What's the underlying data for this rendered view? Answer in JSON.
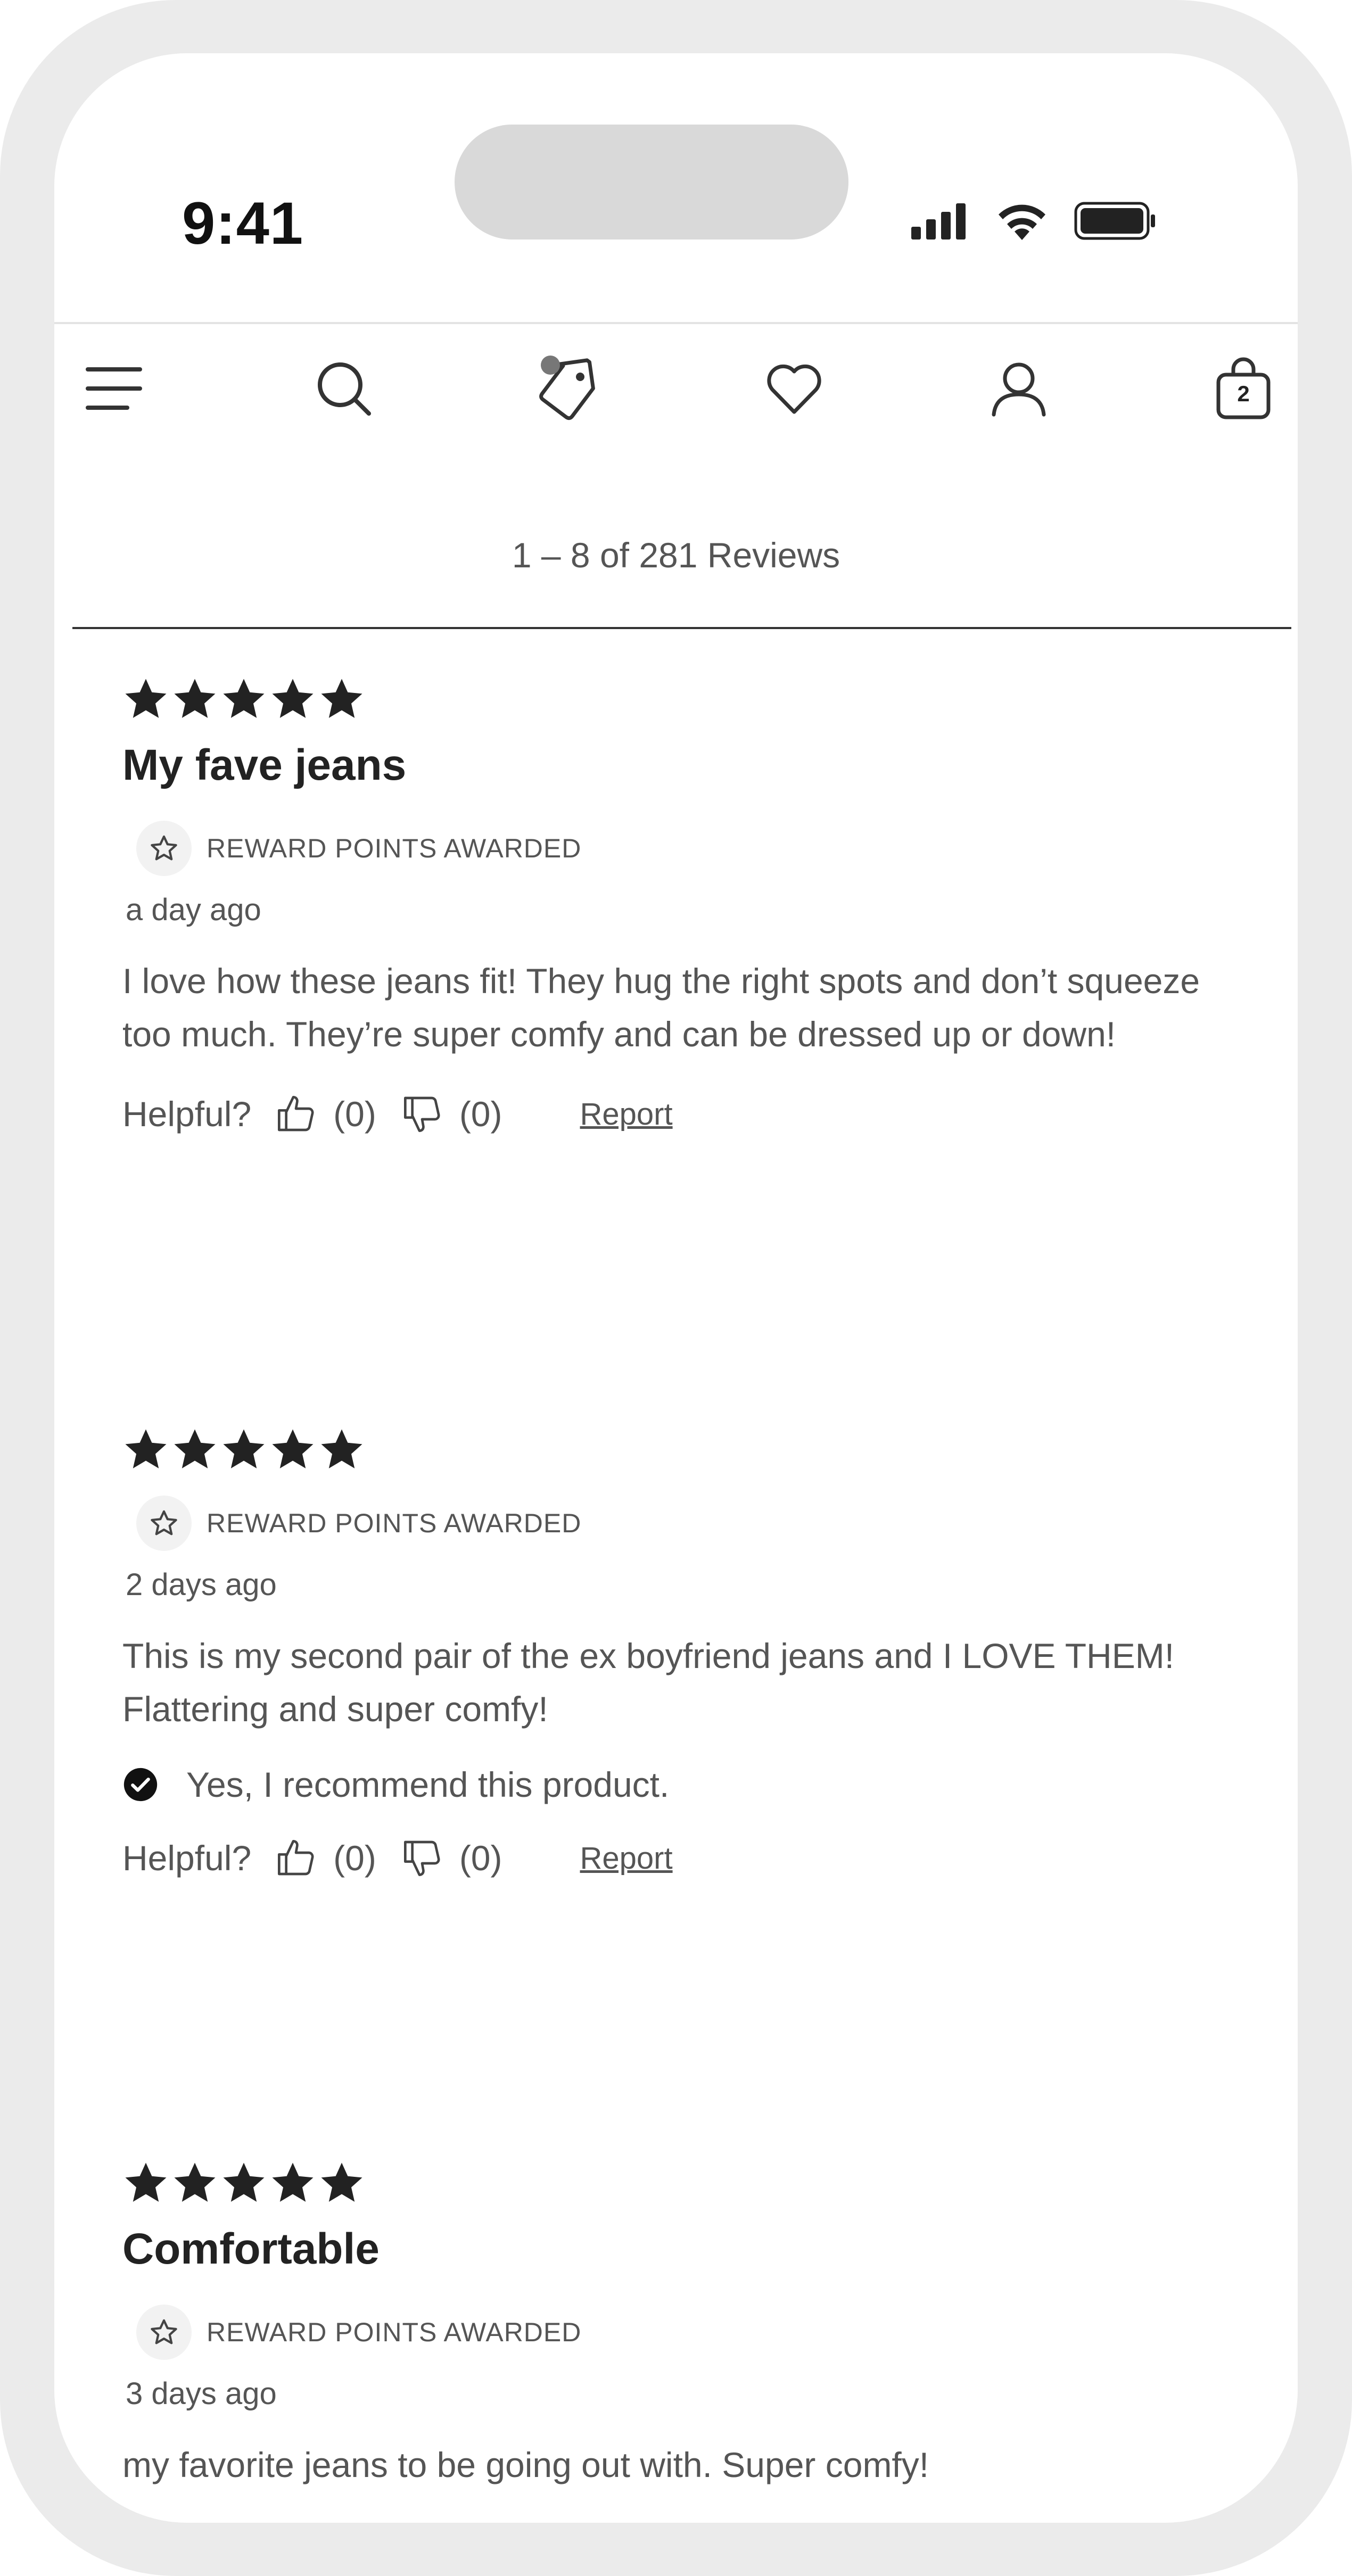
{
  "status": {
    "time": "9:41"
  },
  "nav": {
    "bag_count": "2"
  },
  "reviews_header": {
    "count_text": "1 – 8 of 281 Reviews"
  },
  "reviews": [
    {
      "rating": 5,
      "title": "My fave jeans",
      "reward": "REWARD POINTS AWARDED",
      "date": "a day ago",
      "body": "I love how these jeans fit! They hug the right spots and don’t squeeze too much. They’re super comfy and can be dressed up or down!",
      "helpful_label": "Helpful?",
      "up_count": "(0)",
      "down_count": "(0)",
      "report": "Report"
    },
    {
      "rating": 5,
      "reward": "REWARD POINTS AWARDED",
      "date": "2 days ago",
      "body": "This is my second pair of the ex boyfriend jeans and I LOVE THEM! Flattering and super comfy!",
      "recommend": "Yes, I recommend this product.",
      "helpful_label": "Helpful?",
      "up_count": "(0)",
      "down_count": "(0)",
      "report": "Report"
    },
    {
      "rating": 5,
      "title": "Comfortable",
      "reward": "REWARD POINTS AWARDED",
      "date": "3 days ago",
      "body": "my favorite jeans to be going out with. Super comfy!"
    }
  ],
  "icons": {
    "menu": "menu-icon",
    "search": "search-icon",
    "tag": "tag-icon",
    "wishlist": "heart-icon",
    "account": "user-icon",
    "bag": "shopping-bag-icon"
  },
  "colors": {
    "star": "#222222",
    "text": "#555555",
    "frame": "#ebebeb"
  }
}
